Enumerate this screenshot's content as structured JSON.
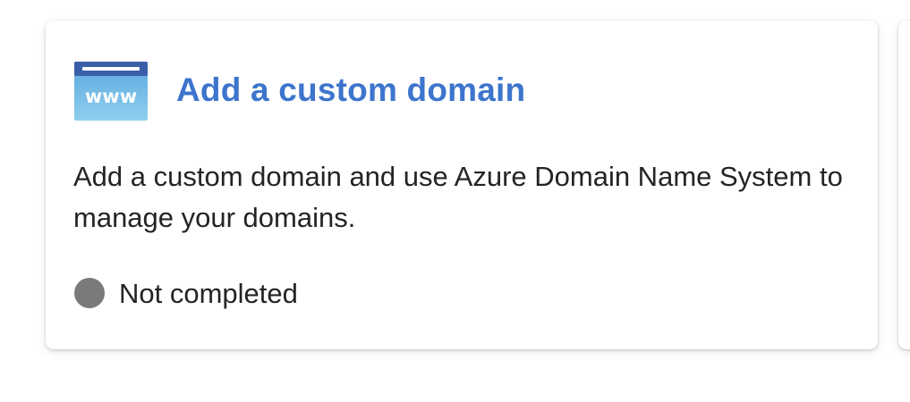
{
  "card": {
    "icon": {
      "name": "www-icon",
      "label": "www",
      "color_top": "#3b5ea8",
      "color_body": "#6fbde6"
    },
    "title": "Add a custom domain",
    "title_color": "#3d75cd",
    "description": "Add a custom domain and use Azure Domain Name System to manage your domains.",
    "status": {
      "icon": "status-circle-icon",
      "text": "Not completed",
      "color": "#7a7a7a"
    }
  }
}
